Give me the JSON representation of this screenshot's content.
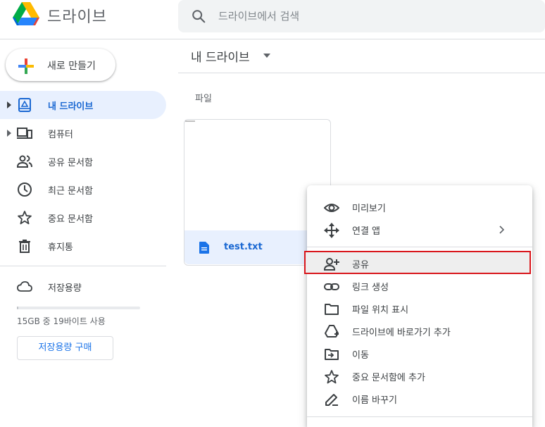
{
  "app": {
    "brand": "드라이브",
    "colors": {
      "accent": "#1a73e8",
      "active_bg": "#e8f0fe",
      "highlight_border": "#d9161c"
    }
  },
  "search": {
    "placeholder": "드라이브에서 검색",
    "icon": "search-icon"
  },
  "new_button": {
    "label": "새로 만들기",
    "icon": "plus-icon"
  },
  "sidebar": {
    "items": [
      {
        "label": "내 드라이브",
        "icon": "my-drive-icon",
        "active": true,
        "expandable": true
      },
      {
        "label": "컴퓨터",
        "icon": "computers-icon",
        "active": false,
        "expandable": true
      },
      {
        "label": "공유 문서함",
        "icon": "shared-icon",
        "active": false
      },
      {
        "label": "최근 문서함",
        "icon": "clock-icon",
        "active": false
      },
      {
        "label": "중요 문서함",
        "icon": "star-icon",
        "active": false
      },
      {
        "label": "휴지통",
        "icon": "trash-icon",
        "active": false
      }
    ],
    "storage": {
      "label": "저장용량",
      "icon": "cloud-icon",
      "usage_text": "15GB 중 19바이트 사용",
      "used_fraction": 0.0,
      "buy_label": "저장용량 구매"
    }
  },
  "main": {
    "title": "내 드라이브",
    "section_label": "파일",
    "files": [
      {
        "name": "test.txt",
        "icon": "doc-icon",
        "selected": true
      }
    ]
  },
  "context_menu": {
    "items": [
      {
        "label": "미리보기",
        "icon": "eye-icon"
      },
      {
        "label": "연결 앱",
        "icon": "move-arrows-icon",
        "submenu": true
      },
      {
        "label": "공유",
        "icon": "add-person-icon",
        "highlighted": true
      },
      {
        "label": "링크 생성",
        "icon": "link-icon"
      },
      {
        "label": "파일 위치 표시",
        "icon": "folder-icon"
      },
      {
        "label": "드라이브에 바로가기 추가",
        "icon": "drive-shortcut-icon"
      },
      {
        "label": "이동",
        "icon": "move-folder-icon"
      },
      {
        "label": "중요 문서함에 추가",
        "icon": "star-icon"
      },
      {
        "label": "이름 바꾸기",
        "icon": "pencil-icon"
      }
    ]
  }
}
